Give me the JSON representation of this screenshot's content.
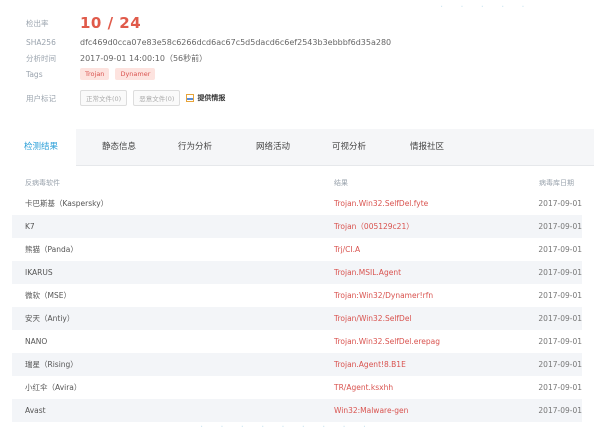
{
  "summary": {
    "ratio_label": "检出率",
    "ratio_value": "10 / 24",
    "sha_label": "SHA256",
    "sha_value": "dfc469d0cca07e83e58c6266dcd6ac67c5d5dacd6c6ef2543b3ebbbf6d35a280",
    "time_label": "分析时间",
    "time_value": "2017-09-01 14:00:10（56秒前）",
    "tags_label": "Tags",
    "tags": [
      "Trojan",
      "Dynamer"
    ],
    "user_label": "用户标记",
    "btn_normal": "正常文件(0)",
    "btn_malicious": "恶意文件(0)",
    "report_label": "提供情报"
  },
  "tabs": [
    "检测结果",
    "静态信息",
    "行为分析",
    "网络活动",
    "可视分析",
    "情报社区"
  ],
  "table": {
    "headers": [
      "反病毒软件",
      "结果",
      "病毒库日期"
    ],
    "rows": [
      {
        "engine": "卡巴斯基（Kaspersky）",
        "result": "Trojan.Win32.SelfDel.fyte",
        "date": "2017-09-01"
      },
      {
        "engine": "K7",
        "result": "Trojan（005129c21）",
        "date": "2017-09-01"
      },
      {
        "engine": "熊猫（Panda）",
        "result": "Trj/CI.A",
        "date": "2017-09-01"
      },
      {
        "engine": "IKARUS",
        "result": "Trojan.MSIL.Agent",
        "date": "2017-09-01"
      },
      {
        "engine": "微软（MSE）",
        "result": "Trojan:Win32/Dynamer!rfn",
        "date": "2017-09-01"
      },
      {
        "engine": "安天（Antiy）",
        "result": "Trojan/Win32.SelfDel",
        "date": "2017-09-01"
      },
      {
        "engine": "NANO",
        "result": "Trojan.Win32.SelfDel.erepag",
        "date": "2017-09-01"
      },
      {
        "engine": "瑞星（Rising）",
        "result": "Trojan.Agent!8.B1E",
        "date": "2017-09-01"
      },
      {
        "engine": "小红伞（Avira）",
        "result": "TR/Agent.ksxhh",
        "date": "2017-09-01"
      },
      {
        "engine": "Avast",
        "result": "Win32:Malware-gen",
        "date": "2017-09-01"
      }
    ]
  },
  "colors": {
    "accent": "#2a9fd8",
    "alert": "#d9534f",
    "tag_bg": "#fde3df"
  }
}
